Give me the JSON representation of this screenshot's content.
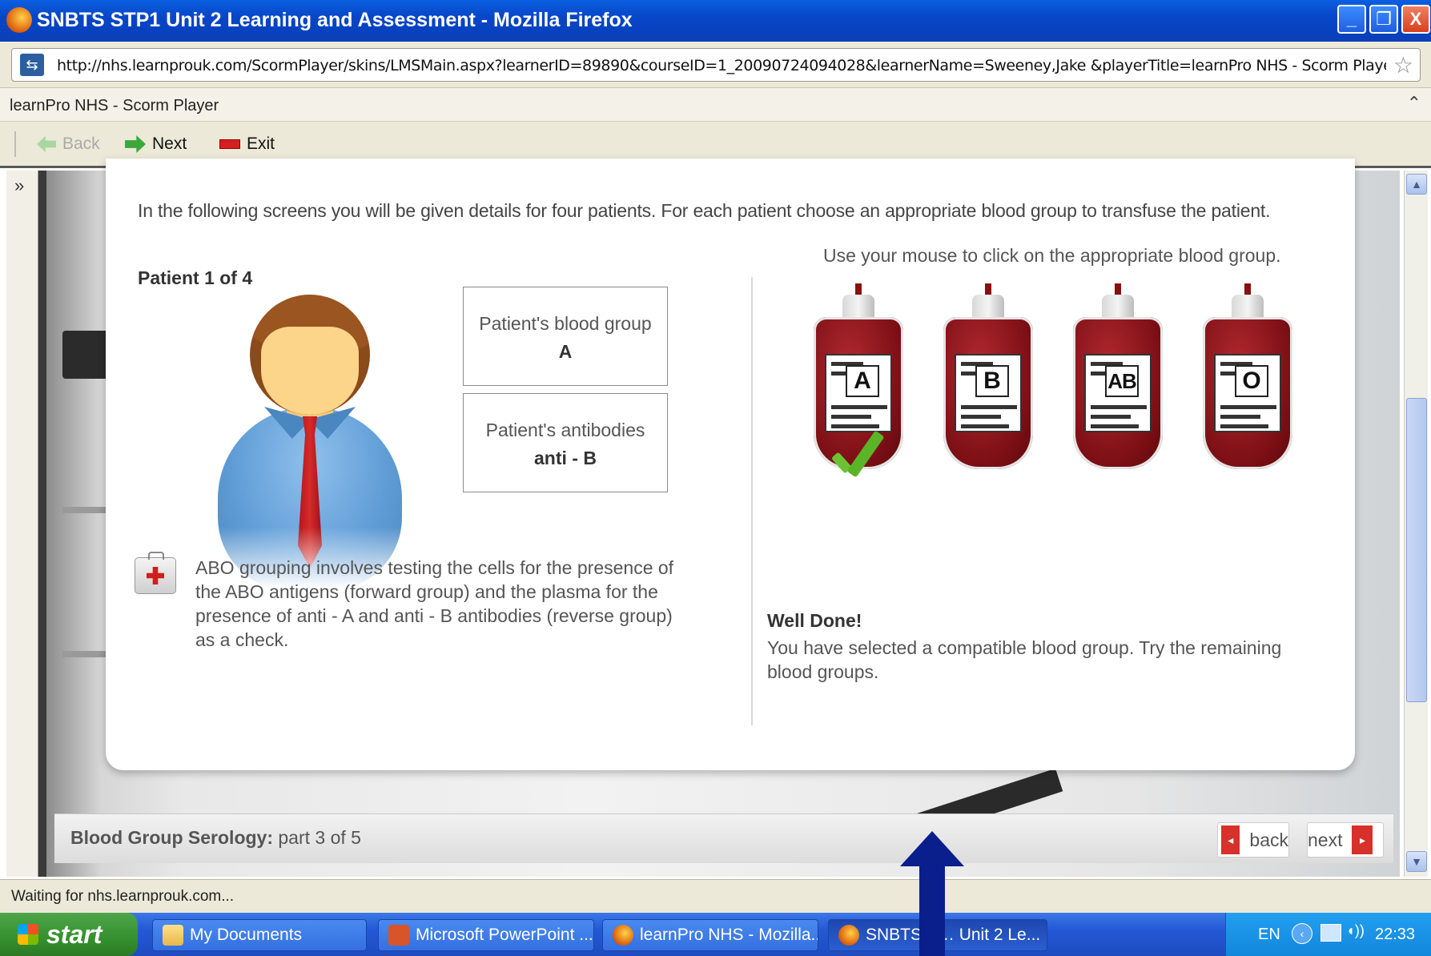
{
  "window": {
    "title": "SNBTS STP1 Unit 2 Learning and Assessment - Mozilla Firefox",
    "controls": {
      "minimize": "_",
      "restore": "❐",
      "close": "X"
    }
  },
  "address_bar": {
    "url": "http://nhs.learnprouk.com/ScormPlayer/skins/LMSMain.aspx?learnerID=89890&courseID=1_20090724094028&learnerName=Sweeney,Jake &playerTitle=learnPro NHS - Scorm Player&skinID=gray&c"
  },
  "player": {
    "title": "learnPro NHS - Scorm Player",
    "collapse_glyph": "⌃",
    "expand_glyph": "»",
    "toolbar": {
      "back": "Back",
      "next": "Next",
      "exit": "Exit"
    }
  },
  "lesson": {
    "intro": "In the following screens you will be given details for four patients. For each patient choose an appropriate blood group to transfuse the patient.",
    "patient_label": "Patient 1 of 4",
    "blood_group_label": "Patient's blood group",
    "blood_group_value": "A",
    "antibodies_label": "Patient's antibodies",
    "antibodies_value": "anti - B",
    "note": "ABO grouping involves testing the cells for the presence of the ABO antigens (forward group) and the plasma for the presence of anti - A and anti - B antibodies (reverse group) as a check.",
    "instruction": "Use your mouse to click on the appropriate blood group.",
    "bags": [
      "A",
      "B",
      "AB",
      "O"
    ],
    "selected_bag": "A",
    "feedback_title": "Well Done!",
    "feedback_text": "You have selected a compatible blood group. Try the remaining blood groups."
  },
  "course_footer": {
    "section": "Blood Group Serology:",
    "part": "part 3 of 5",
    "back": "back",
    "next": "next"
  },
  "status": "Waiting for nhs.learnprouk.com...",
  "taskbar": {
    "start": "start",
    "tasks": [
      {
        "label": "My Documents",
        "icon": "folder-icon"
      },
      {
        "label": "Microsoft PowerPoint ...",
        "icon": "powerpoint-icon"
      },
      {
        "label": "learnPro NHS - Mozilla...",
        "icon": "firefox-icon"
      },
      {
        "label": "SNBTS S… Unit 2 Le...",
        "icon": "firefox-icon"
      }
    ],
    "language": "EN",
    "clock": "22:33"
  },
  "colors": {
    "title_bar": "#0746c8",
    "taskbar": "#2458d4",
    "start_button": "#36902e",
    "nav_accent": "#d8302a",
    "annotation_arrow": "#0a1f8c"
  }
}
